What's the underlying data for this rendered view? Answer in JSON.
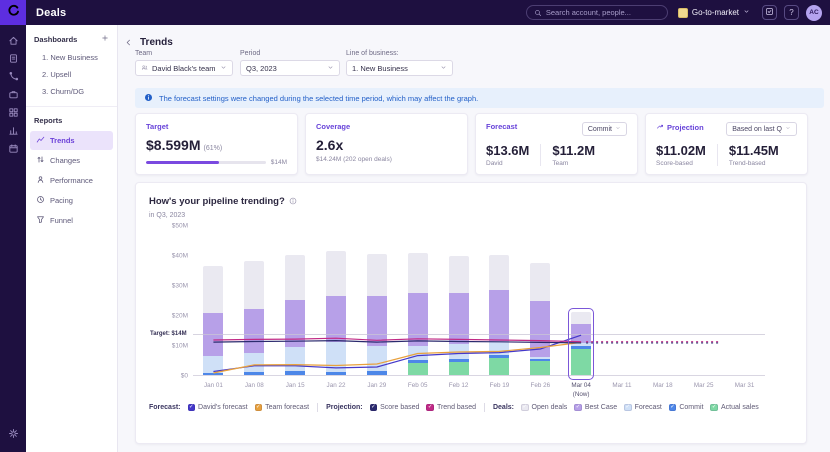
{
  "topbar": {
    "app_title": "Deals",
    "search_placeholder": "Search account, people...",
    "go_to_market": "Go-to-market",
    "help_label": "?",
    "avatar": "AC"
  },
  "rail": {
    "icons": [
      "home-icon",
      "tasks-icon",
      "calls-icon",
      "deals-icon",
      "apps-icon",
      "analytics-icon",
      "calendar-icon"
    ],
    "bottom_icon": "settings-icon"
  },
  "sidebar": {
    "dashboards_label": "Dashboards",
    "dashboards": [
      {
        "label": "1. New Business"
      },
      {
        "label": "2. Upsell"
      },
      {
        "label": "3. Churn/DG"
      }
    ],
    "reports_label": "Reports",
    "reports": [
      {
        "label": "Trends",
        "icon": "trends-icon",
        "selected": true
      },
      {
        "label": "Changes",
        "icon": "changes-icon",
        "selected": false
      },
      {
        "label": "Performance",
        "icon": "performance-icon",
        "selected": false
      },
      {
        "label": "Pacing",
        "icon": "pacing-icon",
        "selected": false
      },
      {
        "label": "Funnel",
        "icon": "funnel-icon",
        "selected": false
      }
    ]
  },
  "header": {
    "title": "Trends"
  },
  "filters": [
    {
      "label": "Team",
      "value": "David Black's team",
      "icon": "people-icon"
    },
    {
      "label": "Period",
      "value": "Q3, 2023",
      "icon": ""
    },
    {
      "label": "Line of business:",
      "value": "1. New Business",
      "icon": ""
    }
  ],
  "banner": {
    "text": "The forecast settings were changed during the selected time period, which may affect the graph."
  },
  "cards": {
    "target": {
      "label": "Target",
      "value": "$8.599M",
      "pct": "(61%)",
      "progress_pct": 61,
      "max": "$14M"
    },
    "coverage": {
      "label": "Coverage",
      "value": "2.6x",
      "sub": "$14.24M (202 open deals)"
    },
    "forecast": {
      "label": "Forecast",
      "dropdown": "Commit",
      "stats": [
        {
          "value": "$13.6M",
          "sub": "David"
        },
        {
          "value": "$11.2M",
          "sub": "Team"
        }
      ]
    },
    "projection": {
      "label": "Projection",
      "dropdown": "Based on last Q",
      "stats": [
        {
          "value": "$11.02M",
          "sub": "Score-based"
        },
        {
          "value": "$11.45M",
          "sub": "Trend-based"
        }
      ]
    }
  },
  "chart": {
    "title": "How's your pipeline trending?",
    "subtitle": "in Q3, 2023"
  },
  "chart_data": {
    "type": "bar",
    "note": "stacked weekly pipeline bars (units $M) with forecast and projection line overlays; dashed projection lines extend past the current week",
    "x": [
      "Jan 01",
      "Jan 08",
      "Jan 15",
      "Jan 22",
      "Jan 29",
      "Feb 05",
      "Feb 12",
      "Feb 19",
      "Feb 26",
      "Mar 04",
      "Mar 11",
      "Mar 18",
      "Mar 25",
      "Mar 31"
    ],
    "now_index": 9,
    "now_label": "(Now)",
    "ylim": [
      0,
      50
    ],
    "y_ticks": [
      {
        "label": "$0",
        "value": 0
      },
      {
        "label": "$10M",
        "value": 10
      },
      {
        "label": "$20M",
        "value": 20
      },
      {
        "label": "$30M",
        "value": 30
      },
      {
        "label": "$40M",
        "value": 40
      },
      {
        "label": "$50M",
        "value": 50
      }
    ],
    "target": {
      "label": "Target: $14M",
      "value": 14
    },
    "bar_series": [
      {
        "name": "Actual sales",
        "color": "#7ed9a4",
        "values": [
          0,
          0,
          0,
          0,
          0,
          4,
          4.5,
          5.5,
          4.5,
          8.6
        ]
      },
      {
        "name": "Commit",
        "color": "#4d87e8",
        "values": [
          0.5,
          1,
          1.5,
          1,
          1.2,
          1,
          1,
          1,
          0.8,
          1
        ]
      },
      {
        "name": "Forecast",
        "color": "#cfe0f7",
        "values": [
          5.8,
          6.5,
          7.7,
          9.9,
          8.3,
          4.6,
          4.7,
          4.7,
          0.8,
          1.2
        ]
      },
      {
        "name": "Best Case",
        "color": "#b7a0e8",
        "values": [
          14.4,
          14.6,
          15.7,
          15.3,
          16.7,
          17.6,
          17,
          17,
          18.5,
          6.2
        ]
      },
      {
        "name": "Open deals",
        "color": "#eae9f1",
        "values": [
          15.8,
          16,
          15,
          15,
          14.3,
          13.4,
          12.5,
          11.8,
          12.8,
          4
        ]
      }
    ],
    "line_series": [
      {
        "name": "David's forecast",
        "color": "#4438c9",
        "values": [
          1.5,
          3.4,
          3.4,
          2.7,
          3,
          6.8,
          7.5,
          7.8,
          9,
          13.6
        ]
      },
      {
        "name": "Team forecast",
        "color": "#e8a13d",
        "values": [
          1,
          3.7,
          3.8,
          3.5,
          4,
          7.5,
          8,
          8.2,
          9.5,
          11.2
        ]
      },
      {
        "name": "Score based",
        "color": "#2b2a6e",
        "values": [
          11.3,
          11.5,
          11.6,
          11.8,
          11.3,
          11.7,
          11.5,
          11.4,
          11.2,
          11.02
        ]
      },
      {
        "name": "Trend based",
        "color": "#c12a86",
        "values": [
          12,
          12.2,
          12.3,
          12.6,
          11.9,
          12.4,
          12.2,
          12,
          11.8,
          11.45
        ]
      }
    ],
    "projections": [
      {
        "name": "Score based projection",
        "color": "#2b2a6e",
        "value": 11.02
      },
      {
        "name": "Trend based projection",
        "color": "#c12a86",
        "value": 11.45
      }
    ]
  },
  "legend": {
    "groups": [
      {
        "label": "Forecast:",
        "items": [
          {
            "label": "David's forecast",
            "color": "#4438c9"
          },
          {
            "label": "Team forecast",
            "color": "#e8a13d"
          }
        ]
      },
      {
        "label": "Projection:",
        "items": [
          {
            "label": "Score based",
            "color": "#2b2a6e"
          },
          {
            "label": "Trend based",
            "color": "#c12a86"
          }
        ]
      },
      {
        "label": "Deals:",
        "items": [
          {
            "label": "Open deals",
            "color": "#eae9f1"
          },
          {
            "label": "Best Case",
            "color": "#b7a0e8"
          },
          {
            "label": "Forecast",
            "color": "#cfe0f7"
          },
          {
            "label": "Commit",
            "color": "#4d87e8"
          },
          {
            "label": "Actual sales",
            "color": "#7ed9a4"
          }
        ]
      }
    ]
  },
  "colors": {
    "topbar_bg": "#1e1040",
    "logo_bg": "#5d2ee0",
    "accent_purple": "#6743d9",
    "selected_nav_bg": "#ebe3fb",
    "banner_bg": "#e7f0fc",
    "banner_text": "#2360c8",
    "progress_fill": "#7a49e0",
    "now_box_border": "#7b57d8"
  }
}
